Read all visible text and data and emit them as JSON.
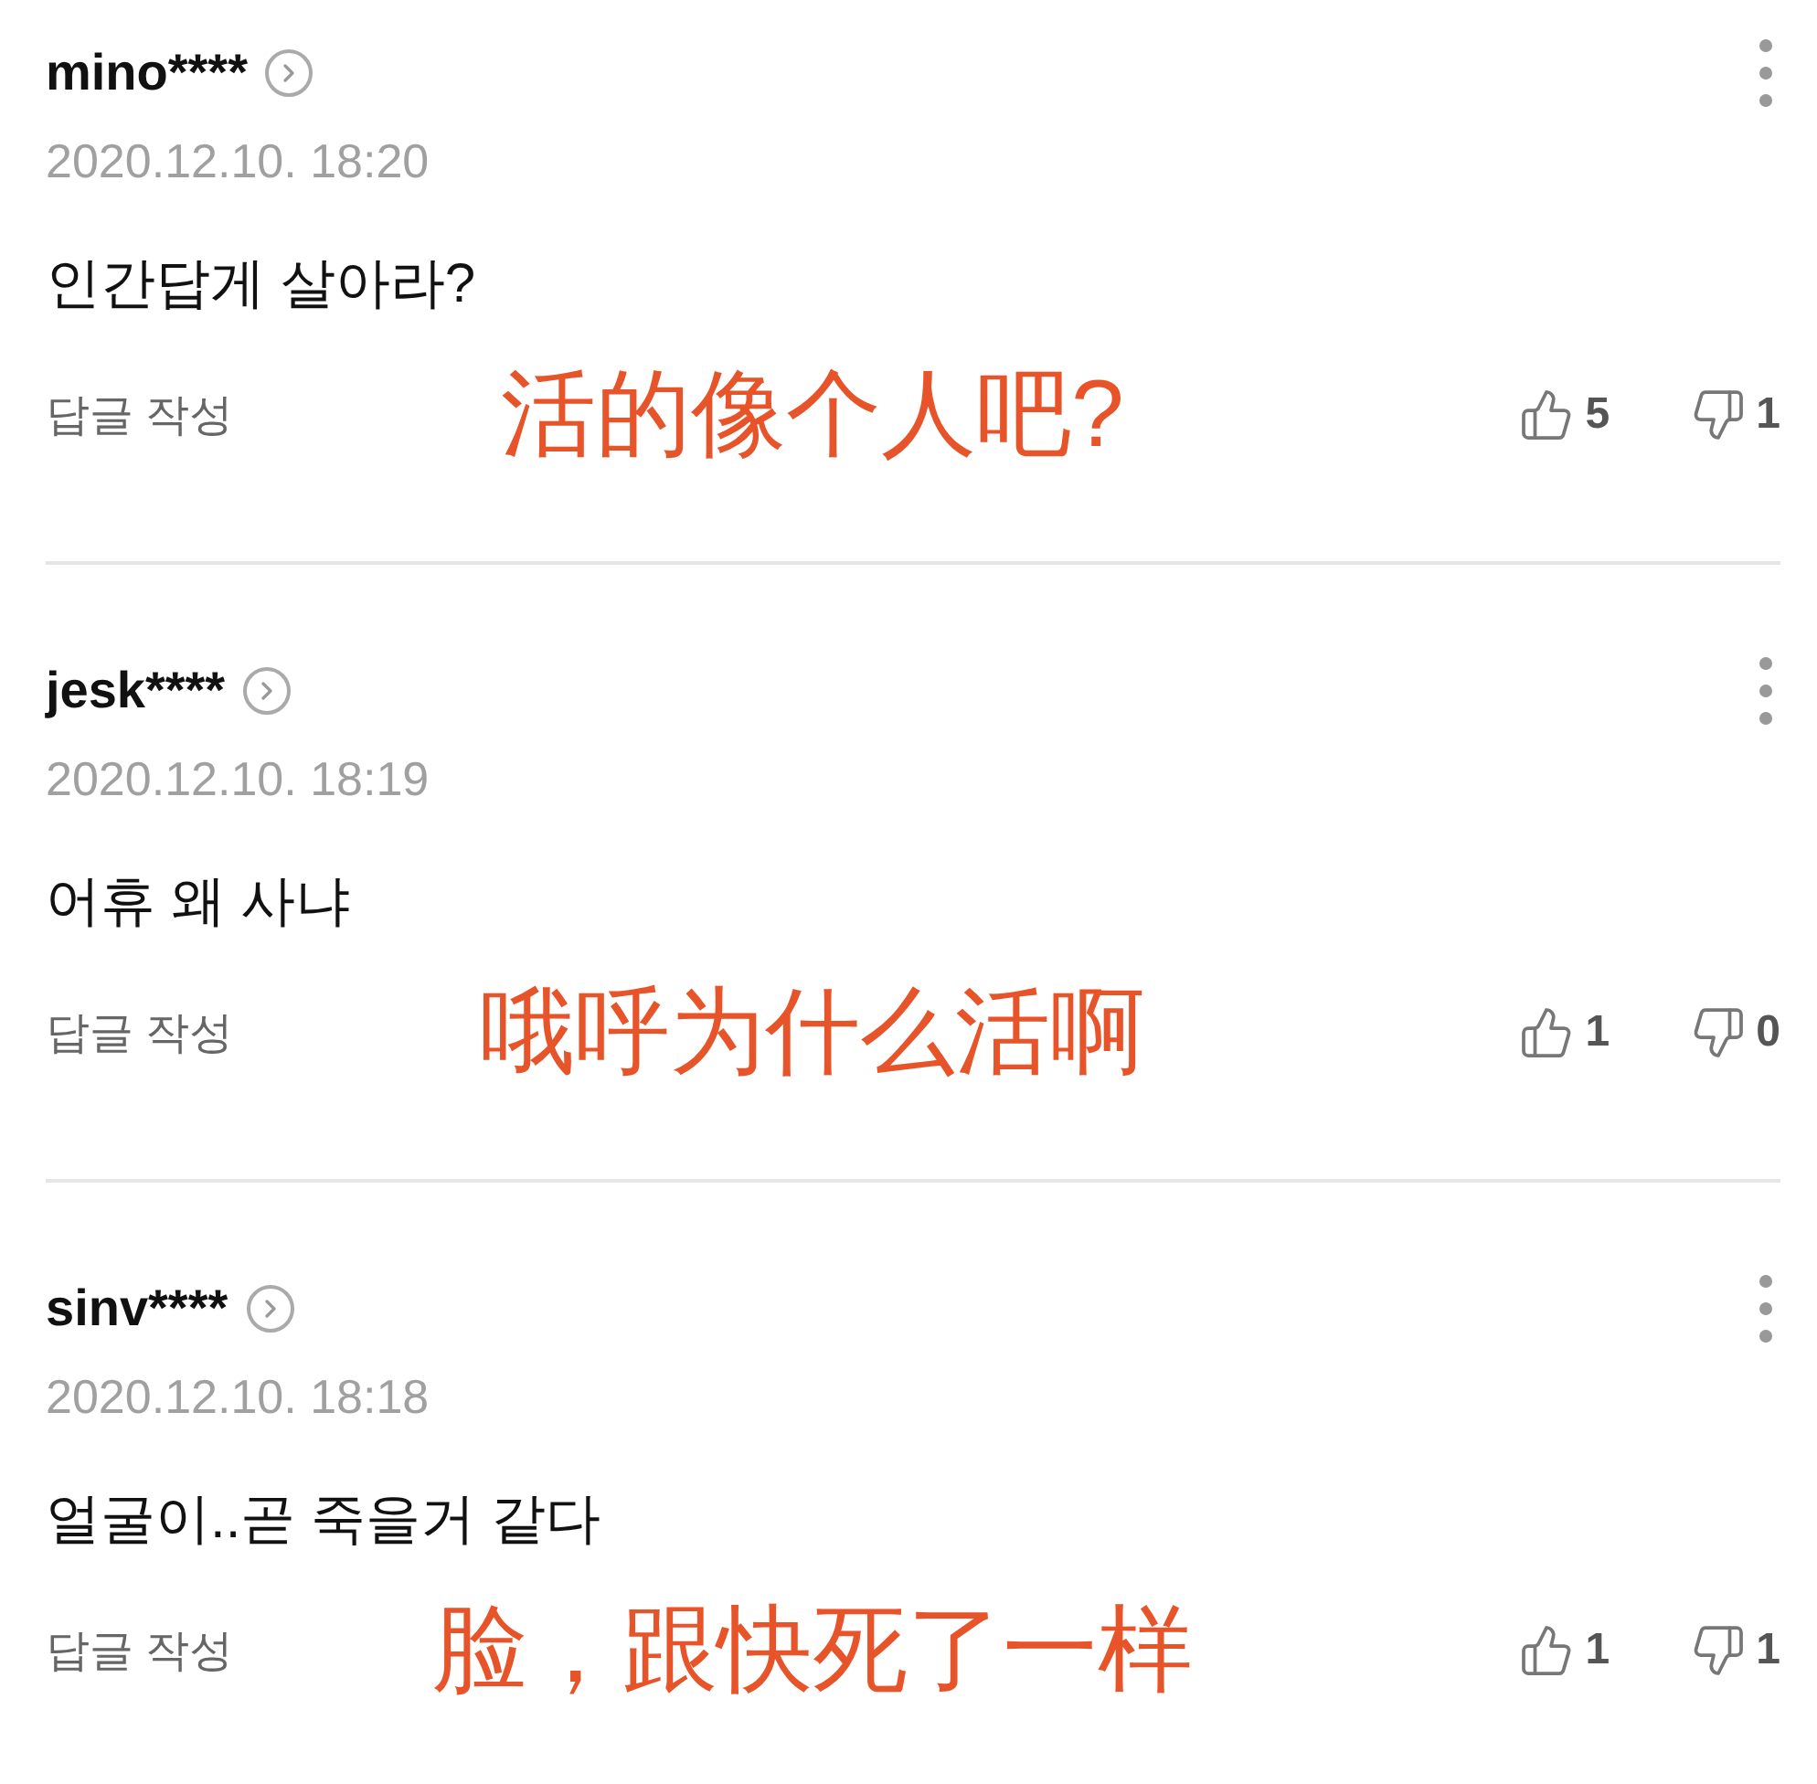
{
  "comments": [
    {
      "author": "mino****",
      "date": "2020.12.10. 18:20",
      "text": "인간답게 살아라?",
      "reply_label": "답글 작성",
      "translation": "活的像个人吧?",
      "likes": "5",
      "dislikes": "1"
    },
    {
      "author": "jesk****",
      "date": "2020.12.10. 18:19",
      "text": "어휴 왜 사냐",
      "reply_label": "답글 작성",
      "translation": "哦呼为什么活啊",
      "likes": "1",
      "dislikes": "0"
    },
    {
      "author": "sinv****",
      "date": "2020.12.10. 18:18",
      "text": "얼굴이..곧 죽을거 같다",
      "reply_label": "답글 작성",
      "translation": "脸，跟快死了一样",
      "likes": "1",
      "dislikes": "1"
    }
  ]
}
